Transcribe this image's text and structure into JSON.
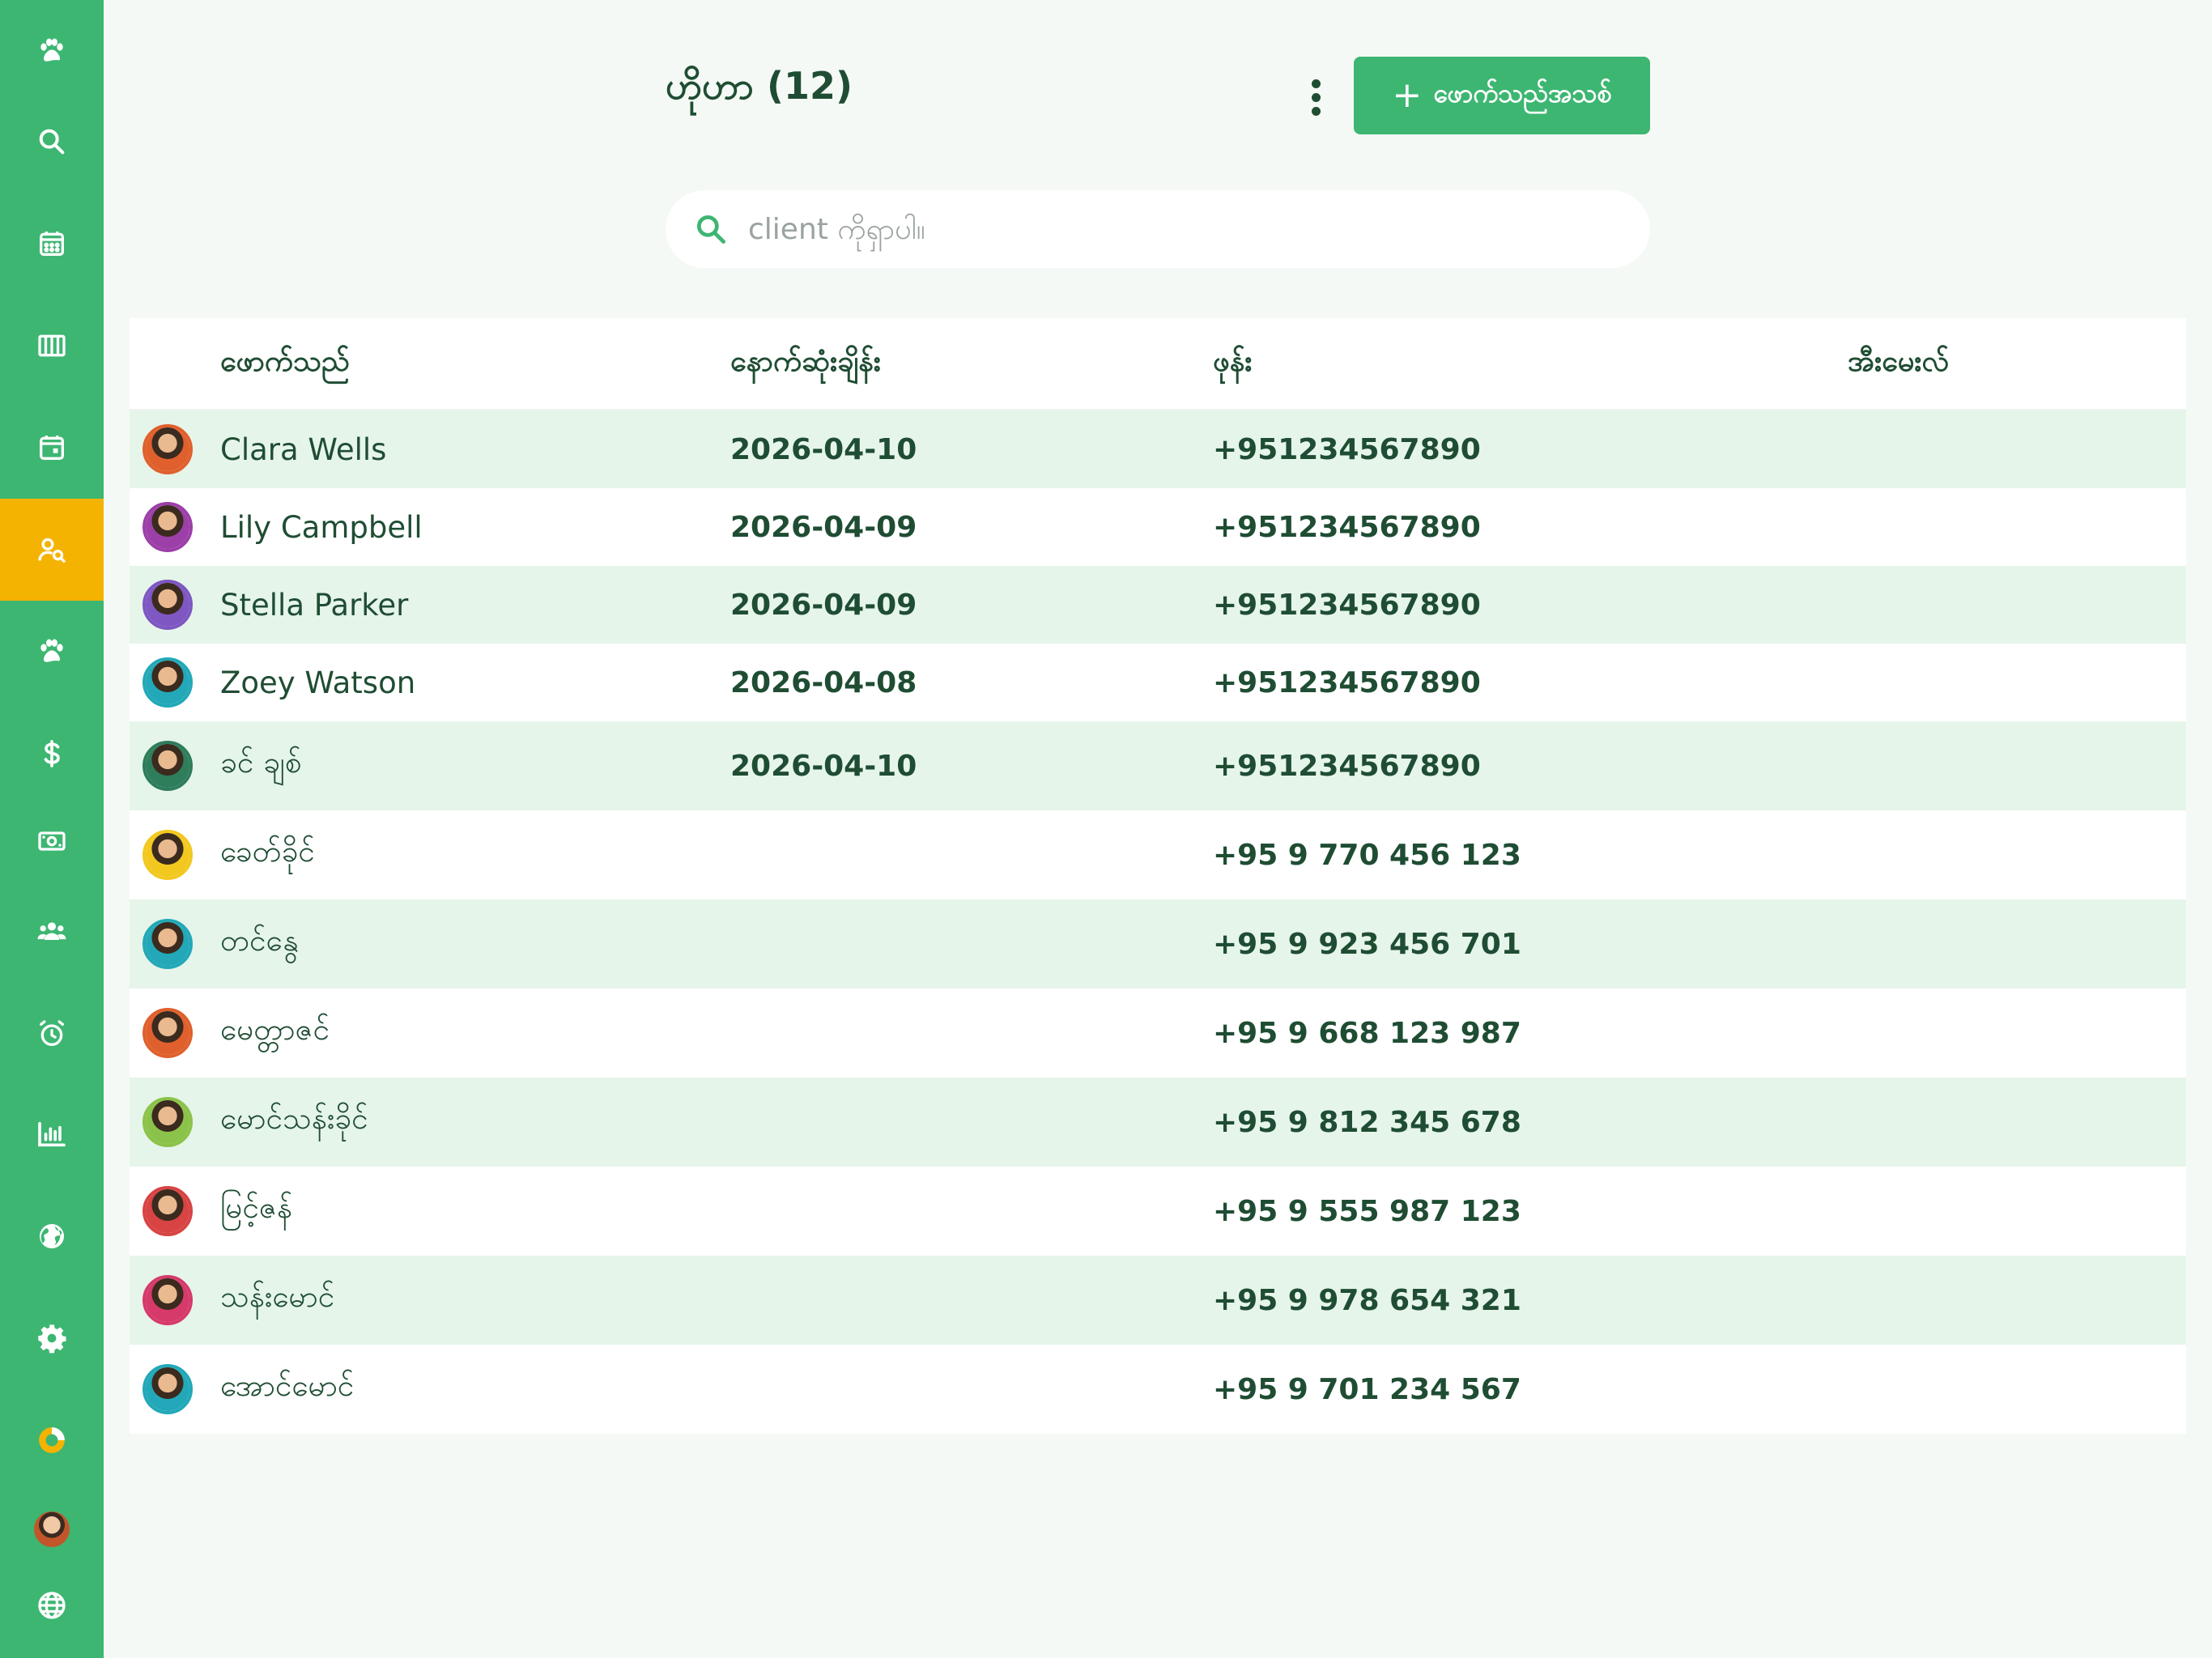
{
  "header": {
    "title": "ဟိုဟာ (12)",
    "add_button_label": "ဖောက်သည်အသစ်",
    "add_button_icon": "plus-icon",
    "more_icon": "more-vertical-icon"
  },
  "search": {
    "placeholder": "client ကိုရှာပါ။",
    "icon": "search-icon"
  },
  "table": {
    "columns": [
      "ဖောက်သည်",
      "နောက်ဆုံးချိန်း",
      "ဖုန်း",
      "အီးမေးလ်"
    ],
    "rows": [
      {
        "name": "Clara Wells",
        "last_visit": "2026-04-10",
        "phone": "+951234567890",
        "email": "",
        "ring": "#e0602d"
      },
      {
        "name": "Lily Campbell",
        "last_visit": "2026-04-09",
        "phone": "+951234567890",
        "email": "",
        "ring": "#9c3fa8"
      },
      {
        "name": "Stella Parker",
        "last_visit": "2026-04-09",
        "phone": "+951234567890",
        "email": "",
        "ring": "#7e57c2"
      },
      {
        "name": "Zoey Watson",
        "last_visit": "2026-04-08",
        "phone": "+951234567890",
        "email": "",
        "ring": "#22a8b8"
      },
      {
        "name": "ခင် ချစ်",
        "last_visit": "2026-04-10",
        "phone": "+951234567890",
        "email": "",
        "ring": "#2e7d5b"
      },
      {
        "name": "ခေတ်ခိုင်",
        "last_visit": "",
        "phone": "+95 9 770 456 123",
        "email": "",
        "ring": "#f2c81f"
      },
      {
        "name": "တင်နွေ",
        "last_visit": "",
        "phone": "+95 9 923 456 701",
        "email": "",
        "ring": "#22a8b8"
      },
      {
        "name": "မေတ္တာဇင်",
        "last_visit": "",
        "phone": "+95 9 668 123 987",
        "email": "",
        "ring": "#e0602d"
      },
      {
        "name": "မောင်သန်းခိုင်",
        "last_visit": "",
        "phone": "+95 9 812 345 678",
        "email": "",
        "ring": "#8bc34a"
      },
      {
        "name": "မြင့်ဇန်",
        "last_visit": "",
        "phone": "+95 9 555 987 123",
        "email": "",
        "ring": "#d84343"
      },
      {
        "name": "သန်းမောင်",
        "last_visit": "",
        "phone": "+95 9 978 654 321",
        "email": "",
        "ring": "#d63a6a"
      },
      {
        "name": "အောင်မောင်",
        "last_visit": "",
        "phone": "+95 9 701 234 567",
        "email": "",
        "ring": "#22a8b8"
      }
    ]
  },
  "sidebar": {
    "items": [
      {
        "icon": "paw-logo-icon"
      },
      {
        "icon": "search-icon"
      },
      {
        "icon": "calendar-grid-icon"
      },
      {
        "icon": "columns-icon"
      },
      {
        "icon": "calendar-event-icon"
      },
      {
        "icon": "client-search-icon",
        "active": true
      },
      {
        "icon": "paw-icon"
      },
      {
        "icon": "dollar-icon"
      },
      {
        "icon": "cash-icon"
      },
      {
        "icon": "group-icon"
      },
      {
        "icon": "alarm-icon"
      },
      {
        "icon": "bar-chart-icon"
      },
      {
        "icon": "globe-icon"
      },
      {
        "icon": "gear-icon"
      },
      {
        "icon": "donut-icon"
      },
      {
        "icon": "user-avatar"
      },
      {
        "icon": "language-icon"
      }
    ]
  },
  "colors": {
    "brand_green": "#3db672",
    "active_yellow": "#f5b301",
    "text_dark_green": "#1f4d33",
    "row_alt": "#e6f5ea"
  }
}
